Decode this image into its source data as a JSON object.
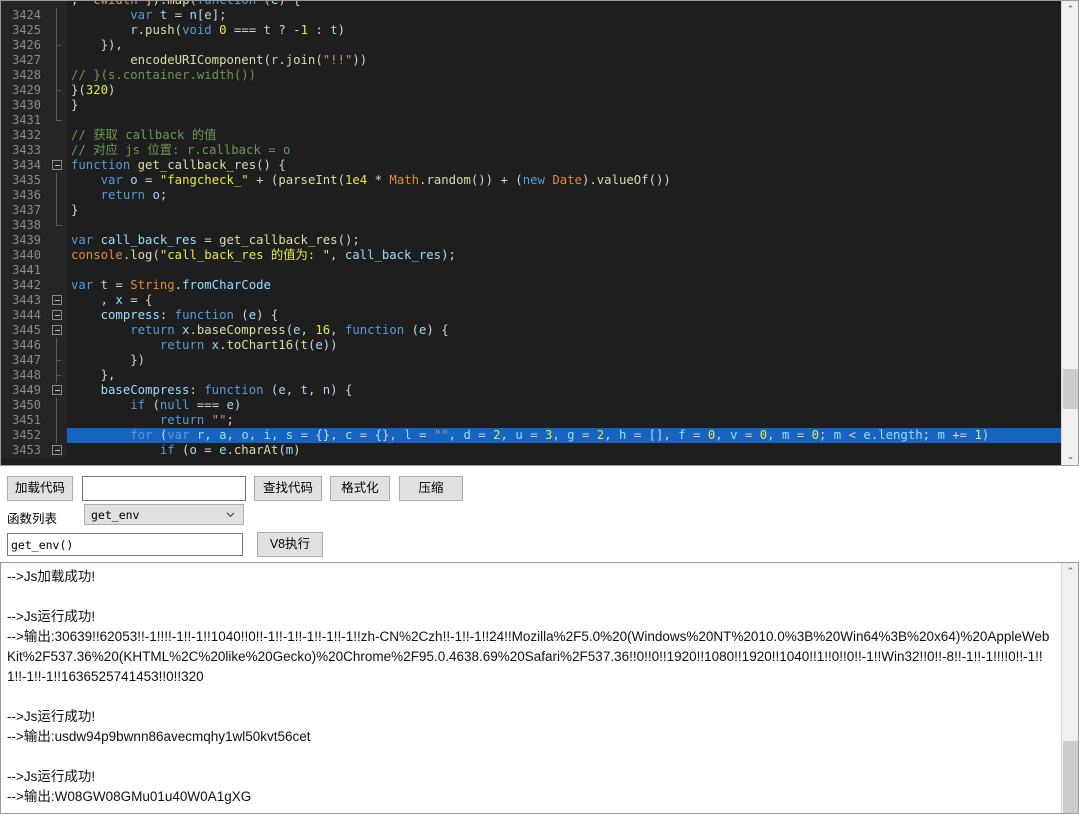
{
  "editor": {
    "first_partial_line": ", \"cwidth\"]).map(function (e) {",
    "lines": [
      {
        "num": "3424",
        "fold": "bar",
        "text": "        var t = n[e];"
      },
      {
        "num": "3425",
        "fold": "bar",
        "text": "        r.push(void 0 === t ? -1 : t)"
      },
      {
        "num": "3426",
        "fold": "corner",
        "text": "    }),"
      },
      {
        "num": "3427",
        "fold": "bar",
        "text": "        encodeURIComponent(r.join(\"!!\"))"
      },
      {
        "num": "3428",
        "fold": "bar",
        "text": "// }(s.container.width())"
      },
      {
        "num": "3429",
        "fold": "corner",
        "text": "}(320)"
      },
      {
        "num": "3430",
        "fold": "bar",
        "text": "}"
      },
      {
        "num": "3431",
        "fold": "end",
        "text": ""
      },
      {
        "num": "3432",
        "fold": "none",
        "text": "// 获取 callback 的值"
      },
      {
        "num": "3433",
        "fold": "none",
        "text": "// 对应 js 位置: r.callback = o"
      },
      {
        "num": "3434",
        "fold": "box",
        "text": "function get_callback_res() {"
      },
      {
        "num": "3435",
        "fold": "bar",
        "text": "    var o = \"fangcheck_\" + (parseInt(1e4 * Math.random()) + (new Date).valueOf())"
      },
      {
        "num": "3436",
        "fold": "bar",
        "text": "    return o;"
      },
      {
        "num": "3437",
        "fold": "bar",
        "text": "}"
      },
      {
        "num": "3438",
        "fold": "end",
        "text": ""
      },
      {
        "num": "3439",
        "fold": "none",
        "text": "var call_back_res = get_callback_res();"
      },
      {
        "num": "3440",
        "fold": "none",
        "text": "console.log(\"call_back_res 的值为: \", call_back_res);"
      },
      {
        "num": "3441",
        "fold": "none",
        "text": ""
      },
      {
        "num": "3442",
        "fold": "none",
        "text": "var t = String.fromCharCode"
      },
      {
        "num": "3443",
        "fold": "box",
        "text": "    , x = {"
      },
      {
        "num": "3444",
        "fold": "box",
        "text": "    compress: function (e) {"
      },
      {
        "num": "3445",
        "fold": "box",
        "text": "        return x.baseCompress(e, 16, function (e) {"
      },
      {
        "num": "3446",
        "fold": "bar",
        "text": "            return x.toChart16(t(e))"
      },
      {
        "num": "3447",
        "fold": "tee",
        "text": "        })"
      },
      {
        "num": "3448",
        "fold": "tee",
        "text": "    },"
      },
      {
        "num": "3449",
        "fold": "box",
        "text": "    baseCompress: function (e, t, n) {"
      },
      {
        "num": "3450",
        "fold": "bar",
        "text": "        if (null === e)"
      },
      {
        "num": "3451",
        "fold": "bar",
        "text": "            return \"\";"
      },
      {
        "num": "3452",
        "fold": "bar",
        "selected": true,
        "text": "        for (var r, a, o, i, s = {}, c = {}, l = \"\", d = 2, u = 3, g = 2, h = [], f = 0, v = 0, m = 0; m < e.length; m += 1)"
      },
      {
        "num": "3453",
        "fold": "box",
        "text": "            if (o = e.charAt(m)"
      }
    ],
    "scrollbar": {
      "up_arrow": "⌃",
      "down_arrow": "⌄"
    }
  },
  "toolbar": {
    "load_code_label": "加载代码",
    "search_input_value": "",
    "search_input_placeholder": "",
    "find_code_label": "查找代码",
    "format_label": "格式化",
    "compress_label": "压缩",
    "function_list_label": "函数列表",
    "function_select_value": "get_env",
    "function_select_options": [
      "get_env"
    ],
    "call_input_value": "get_env()",
    "run_label": "V8执行"
  },
  "console": {
    "lines": [
      "-->Js加载成功!",
      "",
      "-->Js运行成功!",
      "-->输出:30639!!62053!!-1!!!!-1!!-1!!1040!!0!!-1!!-1!!-1!!-1!!-1!!zh-CN%2Czh!!-1!!-1!!24!!Mozilla%2F5.0%20(Windows%20NT%2010.0%3B%20Win64%3B%20x64)%20AppleWebKit%2F537.36%20(KHTML%2C%20like%20Gecko)%20Chrome%2F95.0.4638.69%20Safari%2F537.36!!0!!0!!1920!!1080!!1920!!1040!!1!!0!!0!!-1!!Win32!!0!!-8!!-1!!-1!!!!0!!-1!!1!!-1!!-1!!1636525741453!!0!!320",
      "",
      "-->Js运行成功!",
      "-->输出:usdw94p9bwnn86avecmqhy1wl50kvt56cet",
      "",
      "-->Js运行成功!",
      "-->输出:W08GW08GMu01u40W0A1gXG"
    ],
    "scrollbar": {
      "up_arrow": "⌃"
    }
  },
  "colors": {
    "editor_bg": "#1e1e1e",
    "gutter_bg": "#252526",
    "selection": "#1664c0",
    "button_face": "#e1e1e1"
  }
}
